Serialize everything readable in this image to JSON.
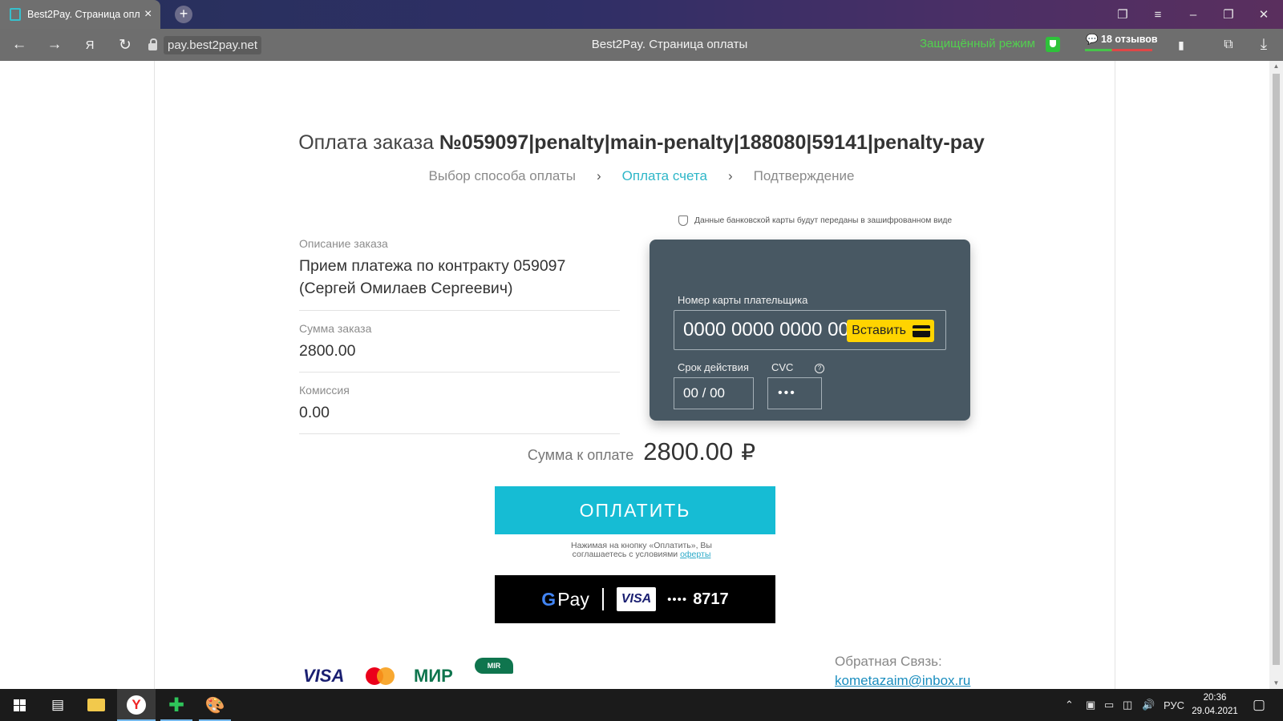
{
  "browser": {
    "tab_title": "Best2Pay. Страница оплаты",
    "url": "pay.best2pay.net",
    "page_title": "Best2Pay. Страница оплаты",
    "protected_mode": "Защищённый режим",
    "reviews": "18 отзывов"
  },
  "order": {
    "title_prefix": "Оплата заказа",
    "title_number": "№059097|penalty|main-penalty|188080|59141|penalty-pay",
    "steps": [
      "Выбор способа оплаты",
      "Оплата счета",
      "Подтверждение"
    ],
    "active_step": "Оплата счета",
    "description_label": "Описание заказа",
    "description_value": "Прием платежа по контракту 059097 (Сергей Омилаев Сергеевич)",
    "amount_label": "Сумма заказа",
    "amount_value": "2800.00",
    "commission_label": "Комиссия",
    "commission_value": "0.00"
  },
  "card_form": {
    "secure_note": "Данные банковской карты будут переданы в зашифрованном виде",
    "card_number_label": "Номер карты плательщика",
    "card_number_placeholder": "0000 0000 0000 0000",
    "paste_button": "Вставить",
    "expiry_label": "Срок действия",
    "expiry_placeholder": "00 / 00",
    "cvc_label": "CVC",
    "cvc_placeholder": "•••"
  },
  "payment": {
    "total_label": "Сумма к оплате",
    "total_value": "2800.00",
    "currency": "₽",
    "pay_button": "ОПЛАТИТЬ",
    "terms_line1": "Нажимая на кнопку «Оплатить», Вы",
    "terms_line2": "соглашаетесь с условиями",
    "terms_link": "оферты",
    "gpay_label": "Pay",
    "gpay_card_brand": "VISA",
    "gpay_card_dots": "••••",
    "gpay_card_last4": "8717"
  },
  "footer": {
    "feedback_label": "Обратная Связь:",
    "feedback_email": "kometazaim@inbox.ru",
    "logos": [
      "VISA",
      "mastercard",
      "МИР",
      "MIR"
    ]
  },
  "taskbar": {
    "language": "РУС",
    "time": "20:36",
    "date": "29.04.2021"
  },
  "colors": {
    "accent": "#16bcd4",
    "card_bg": "#485863",
    "paste_button": "#ffd400",
    "protected_green": "#52d04f"
  }
}
